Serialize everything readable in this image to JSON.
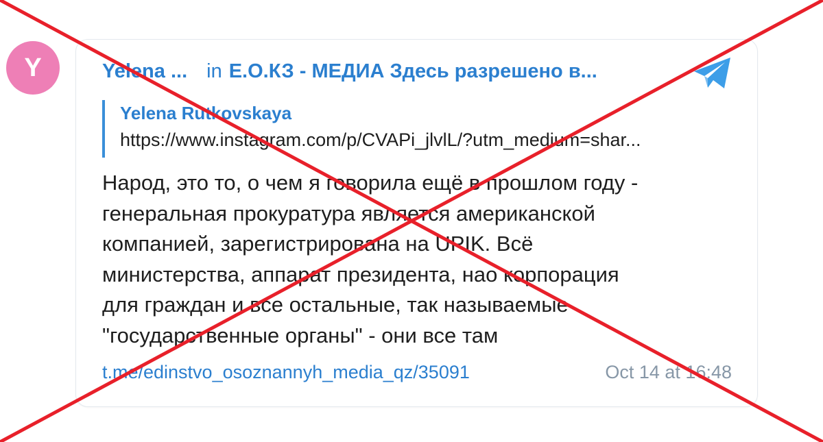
{
  "colors": {
    "avatar_bg": "#ee7fb6",
    "link": "#2b7fcf",
    "text": "#1e1e1e",
    "muted": "#8797a7",
    "quote_bar": "#3a8fd9",
    "telegram": "#3d9ee8",
    "cross": "#e8202a"
  },
  "avatar": {
    "letter": "Y"
  },
  "post": {
    "author_short": "Yelena ...",
    "in_word": "in",
    "channel": "Е.О.КЗ - МЕДИА Здесь разрешено в...",
    "telegram_icon": "telegram-paper-plane-icon",
    "quote": {
      "author": "Yelena Rutkovskaya",
      "url": "https://www.instagram.com/p/CVAPi_jlvlL/?utm_medium=shar..."
    },
    "message_lines": [
      "Народ, это то, о чем я говорила ещё в прошлом году -",
      "генеральная прокуратура является американской",
      "компанией, зарегистрирована на UPIK. Всё",
      "министерства, аппарат президента, нао корпорация",
      "для граждан и все остальные, так называемые",
      "\"государственные органы\" - они все там"
    ],
    "link": "t.me/edinstvo_osoznannyh_media_qz/35091",
    "timestamp": "Oct 14 at 16:48"
  }
}
